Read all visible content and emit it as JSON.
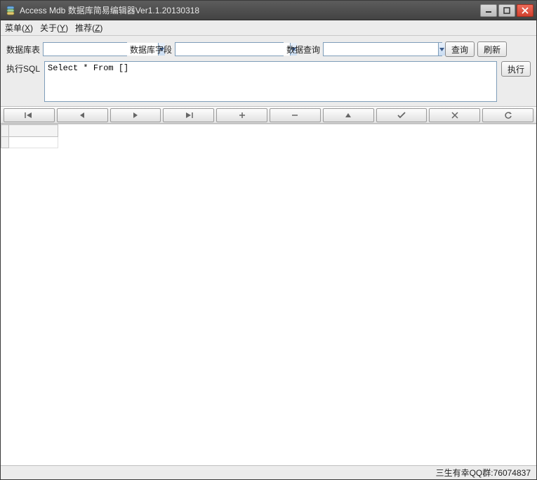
{
  "window": {
    "title": "Access Mdb 数据库简易编辑器Ver1.1.20130318"
  },
  "menu": {
    "items": [
      {
        "label": "菜单",
        "hotkey": "X"
      },
      {
        "label": "关于",
        "hotkey": "Y"
      },
      {
        "label": "推荐",
        "hotkey": "Z"
      }
    ]
  },
  "query": {
    "table_label": "数据库表",
    "table_value": "",
    "field_label": "数据库字段",
    "field_value": "",
    "query_label": "数据查询",
    "query_value": "",
    "query_button": "查询",
    "refresh_button": "刷新",
    "sql_label": "执行SQL",
    "sql_value": "Select * From []",
    "execute_button": "执行"
  },
  "nav": {
    "first": "first",
    "prev": "prev",
    "next": "next",
    "last": "last",
    "add": "add",
    "remove": "remove",
    "edit": "edit",
    "confirm": "confirm",
    "cancel": "cancel",
    "refresh": "refresh"
  },
  "status": {
    "text": "三生有幸QQ群:76074837"
  }
}
